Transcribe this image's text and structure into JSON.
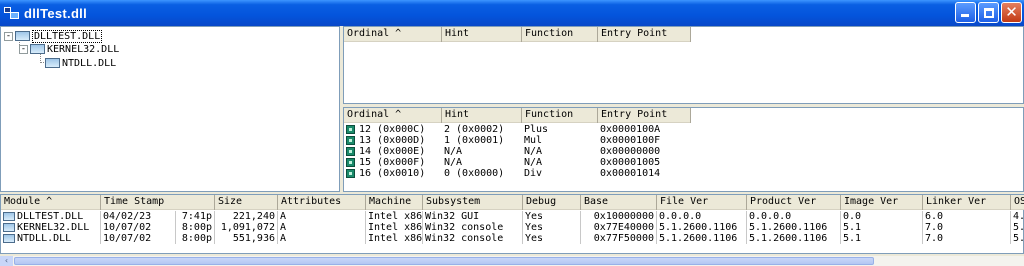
{
  "window": {
    "title": "dllTest.dll"
  },
  "tree": {
    "items": [
      {
        "label": "DLLTEST.DLL",
        "expander": "-"
      },
      {
        "label": "KERNEL32.DLL",
        "expander": "-"
      },
      {
        "label": "NTDLL.DLL",
        "expander": ""
      }
    ]
  },
  "imports": {
    "columns": [
      "Ordinal ^",
      "Hint",
      "Function",
      "Entry Point"
    ]
  },
  "exports": {
    "columns": [
      "Ordinal ^",
      "Hint",
      "Function",
      "Entry Point"
    ],
    "rows": [
      {
        "ordinal": "12  (0x000C)",
        "hint": "2  (0x0002)",
        "function": "Plus",
        "entry": "0x0000100A"
      },
      {
        "ordinal": "13  (0x000D)",
        "hint": "1  (0x0001)",
        "function": "Mul",
        "entry": "0x0000100F"
      },
      {
        "ordinal": "14  (0x000E)",
        "hint": "N/A",
        "function": "N/A",
        "entry": "0x00000000"
      },
      {
        "ordinal": "15  (0x000F)",
        "hint": "N/A",
        "function": "N/A",
        "entry": "0x00001005"
      },
      {
        "ordinal": "16  (0x0010)",
        "hint": "0  (0x0000)",
        "function": "Div",
        "entry": "0x00001014"
      }
    ]
  },
  "modules": {
    "columns": [
      "Module ^",
      "Time Stamp",
      "Size",
      "Attributes",
      "Machine",
      "Subsystem",
      "Debug",
      "Base",
      "File Ver",
      "Product Ver",
      "Image Ver",
      "Linker Ver",
      "OS"
    ],
    "rows": [
      {
        "module": "DLLTEST.DLL",
        "date": "04/02/23",
        "time": "7:41p",
        "size": "221,240",
        "attributes": "A",
        "machine": "Intel x86",
        "subsystem": "Win32 GUI",
        "debug": "Yes",
        "base": "0x10000000",
        "file_ver": "0.0.0.0",
        "product_ver": "0.0.0.0",
        "image_ver": "0.0",
        "linker_ver": "6.0",
        "os": "4."
      },
      {
        "module": "KERNEL32.DLL",
        "date": "10/07/02",
        "time": "8:00p",
        "size": "1,091,072",
        "attributes": "A",
        "machine": "Intel x86",
        "subsystem": "Win32 console",
        "debug": "Yes",
        "base": "0x77E40000",
        "file_ver": "5.1.2600.1106",
        "product_ver": "5.1.2600.1106",
        "image_ver": "5.1",
        "linker_ver": "7.0",
        "os": "5."
      },
      {
        "module": "NTDLL.DLL",
        "date": "10/07/02",
        "time": "8:00p",
        "size": "551,936",
        "attributes": "A",
        "machine": "Intel x86",
        "subsystem": "Win32 console",
        "debug": "Yes",
        "base": "0x77F50000",
        "file_ver": "5.1.2600.1106",
        "product_ver": "5.1.2600.1106",
        "image_ver": "5.1",
        "linker_ver": "7.0",
        "os": "5."
      }
    ]
  }
}
